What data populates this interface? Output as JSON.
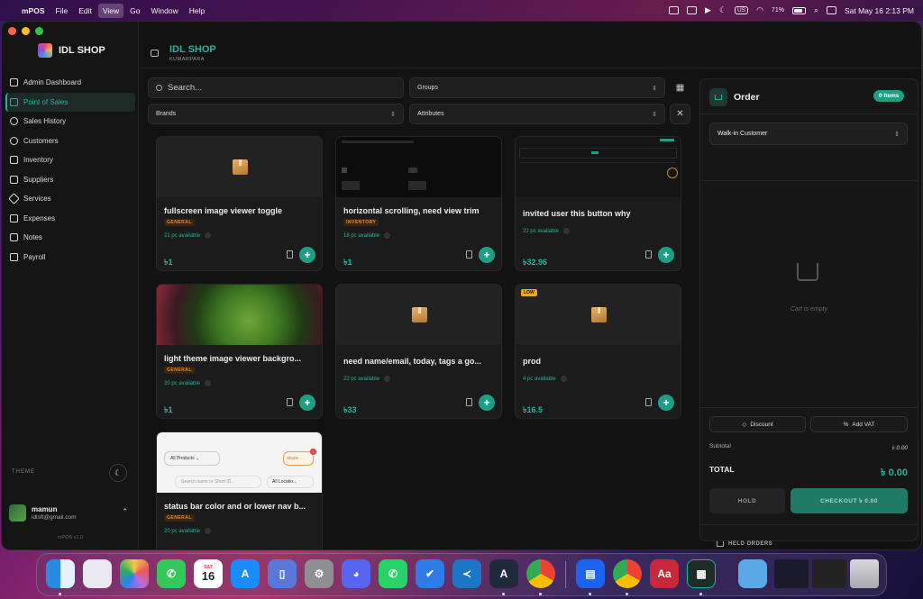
{
  "menubar": {
    "app_name": "mPOS",
    "menus": [
      "File",
      "Edit",
      "View",
      "Go",
      "Window",
      "Help"
    ],
    "active_menu": "View",
    "keyboard": "US",
    "battery": "71%",
    "datetime": "Sat May 16  2:13 PM"
  },
  "sidebar": {
    "brand": "IDL SHOP",
    "items": [
      {
        "label": "Admin Dashboard",
        "icon": "grid-icon"
      },
      {
        "label": "Point of Sales",
        "icon": "pos-icon"
      },
      {
        "label": "Sales History",
        "icon": "clock-icon"
      },
      {
        "label": "Customers",
        "icon": "users-icon"
      },
      {
        "label": "Inventory",
        "icon": "box-icon"
      },
      {
        "label": "Suppliers",
        "icon": "truck-icon"
      },
      {
        "label": "Services",
        "icon": "wrench-icon"
      },
      {
        "label": "Expenses",
        "icon": "receipt-icon"
      },
      {
        "label": "Notes",
        "icon": "note-icon"
      },
      {
        "label": "Payroll",
        "icon": "document-icon"
      }
    ],
    "active_item": "Point of Sales",
    "theme_label": "THEME",
    "user": {
      "name": "mamun",
      "email": "idlsft@gmail.com"
    },
    "version": "mPOS v1.0"
  },
  "topbar": {
    "shop_name": "IDL SHOP",
    "location": "KUMARPARA"
  },
  "filters": {
    "search_placeholder": "Search...",
    "groups": "Groups",
    "brands": "Brands",
    "attributes": "Attributes"
  },
  "products": [
    {
      "title": "fullscreen image viewer toggle",
      "tag": "GENERAL",
      "available": "21 pc available",
      "price": "৳1",
      "image": "placeholder"
    },
    {
      "title": "horizontal scrolling, need view trim",
      "tag": "INVENTORY",
      "available": "18 pc available",
      "price": "৳1",
      "image": "screenshot"
    },
    {
      "title": "invited user this button why",
      "tag": "",
      "available": "22 pc available",
      "price": "৳32.96",
      "image": "screenshot"
    },
    {
      "title": "light theme image viewer backgro...",
      "tag": "GENERAL",
      "available": "20 pc available",
      "price": "৳1",
      "image": "leaf-photo"
    },
    {
      "title": "need name/email, today, tags a go...",
      "tag": "",
      "available": "22 pc available",
      "price": "৳33",
      "image": "placeholder"
    },
    {
      "title": "prod",
      "tag": "",
      "available": "4 pc available",
      "price": "৳16.5",
      "image": "placeholder",
      "badge": "LOW"
    },
    {
      "title": "status bar color and or lower nav b...",
      "tag": "GENERAL",
      "available": "20 pc available",
      "price": "",
      "image": "app-screenshot",
      "image_text": {
        "all_products": "All Products",
        "search": "Search name or Short ID...",
        "location": "All Locatio...",
        "shorts": "Shorts",
        "shorts_count": "1"
      }
    }
  ],
  "order": {
    "title": "Order",
    "items_count": "0 Items",
    "customer": "Walk-in Customer",
    "empty_text": "Cart is empty",
    "discount_label": "Discount",
    "vat_label": "Add VAT",
    "subtotal_label": "Subtotal",
    "subtotal_value": "৳ 0.00",
    "total_label": "TOTAL",
    "total_value": "৳ 0.00",
    "hold_label": "HOLD",
    "checkout_label": "CHECKOUT ৳ 0.00",
    "held_orders_label": "HELD ORDERS"
  },
  "dock": {
    "calendar_month": "SAT",
    "calendar_day": "16",
    "apps": [
      "finder-icon",
      "launchpad-icon",
      "photos-icon",
      "facetime-icon",
      "calendar-icon",
      "app-store-icon",
      "simulator-icon",
      "system-settings-icon",
      "discord-icon",
      "whatsapp-icon",
      "tasks-icon",
      "vscode-icon",
      "android-studio-icon",
      "chrome-icon",
      "docker-icon",
      "chrome-icon",
      "dictionary-icon",
      "mpos-icon",
      "folder-icon",
      "window-thumbnail",
      "window-thumbnail",
      "trash-icon"
    ]
  },
  "colors": {
    "accent": "#27b39a",
    "accent_dark": "#1e9f85",
    "warning": "#f0a81c",
    "tag": "#e38a2c"
  }
}
